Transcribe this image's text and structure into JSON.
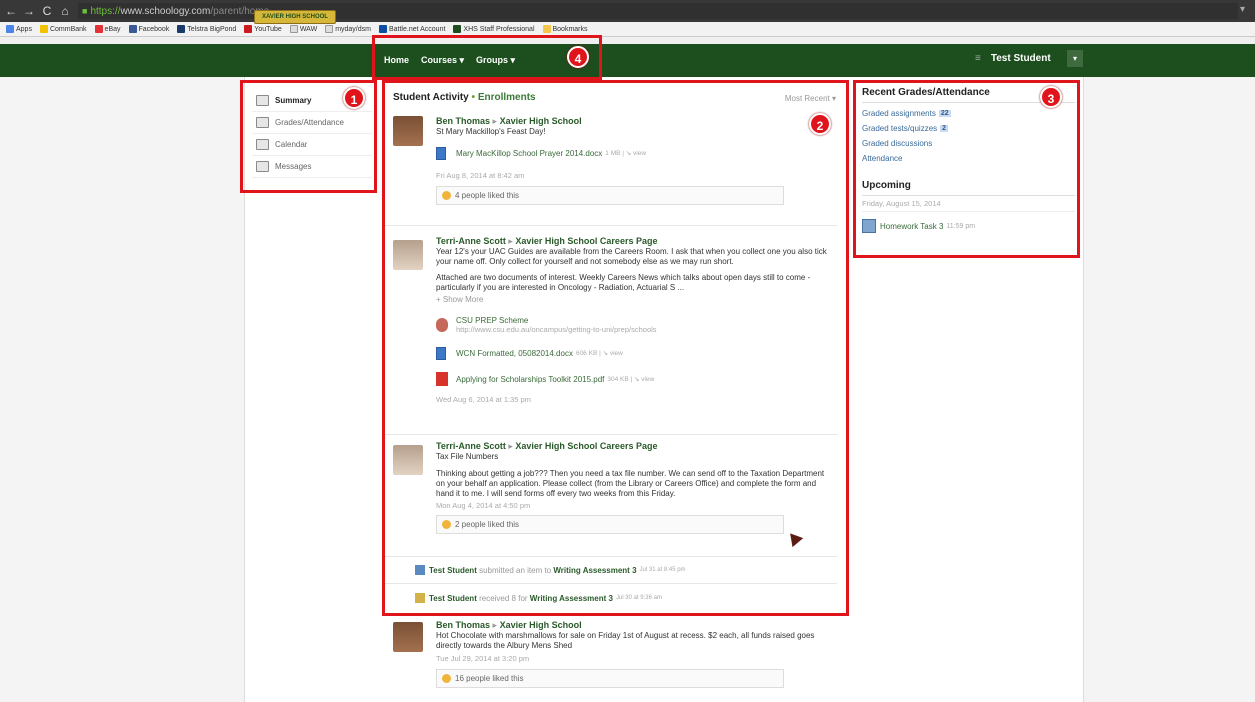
{
  "browser": {
    "url_secure": "https://",
    "url_host": "www.schoology.com",
    "url_path": "/parent/home",
    "bookmarks": [
      "Apps",
      "CommBank",
      "eBay",
      "Facebook",
      "Telstra BigPond",
      "YouTube",
      "WAW",
      "myday/dsm",
      "Battle.net Account",
      "XHS Staff Professional",
      "Bookmarks"
    ]
  },
  "header": {
    "logo_text": "XAVIER HIGH SCHOOL ALBURY",
    "nav": [
      "Home",
      "Courses ▾",
      "Groups ▾"
    ],
    "user_name": "Test Student",
    "menu_icon": "≡",
    "caret": "▾"
  },
  "sidebar": {
    "items": [
      {
        "label": "Summary",
        "icon": "summary-icon"
      },
      {
        "label": "Grades/Attendance",
        "icon": "grades-icon"
      },
      {
        "label": "Calendar",
        "icon": "calendar-icon"
      },
      {
        "label": "Messages",
        "icon": "messages-icon"
      }
    ]
  },
  "feed": {
    "title": "Student Activity",
    "sep": " • ",
    "enrollments": "Enrollments",
    "sort": "Most Recent ▾",
    "posts": [
      {
        "author": "Ben Thomas",
        "target": "Xavier High School",
        "text": "St Mary Mackillop's Feast Day!",
        "attachments": [
          {
            "name": "Mary MacKillop School Prayer 2014.docx",
            "meta": "1 MB | ↘ view",
            "type": "doc"
          }
        ],
        "time": "Fri Aug 8, 2014 at 8:42 am",
        "likes": "4 people liked this"
      },
      {
        "author": "Terri-Anne Scott",
        "target": "Xavier High School Careers Page",
        "text1": "Year 12's your UAC Guides are available from the Careers Room.  I ask that when you collect one you also tick your name off.  Only collect for yourself and not somebody else as we may run short.",
        "text2": "Attached are two documents of interest. Weekly Careers News which talks about open days still to come - particularly if you are interested in Oncology - Radiation, Actuarial S ...",
        "show_more": "+ Show More",
        "link_name": "CSU PREP Scheme",
        "link_url": "http://www.csu.edu.au/oncampus/getting-to-uni/prep/schools",
        "attachments": [
          {
            "name": "WCN Formatted, 05082014.docx",
            "meta": "606 KB | ↘ view",
            "type": "doc"
          },
          {
            "name": "Applying for Scholarships Toolkit 2015.pdf",
            "meta": "304 KB | ↘ view",
            "type": "pdf"
          }
        ],
        "time": "Wed Aug 6, 2014 at 1:35 pm"
      },
      {
        "author": "Terri-Anne Scott",
        "target": "Xavier High School Careers Page",
        "text1": "Tax File Numbers",
        "text2": "Thinking about getting a job??? Then you need a tax file number.  We can send off to the Taxation Department on your behalf an application.  Please collect (from the Library or Careers Office) and complete the form and hand it to me.  I will send forms off every two weeks from this Friday.",
        "time": "Mon Aug 4, 2014 at 4:50 pm",
        "likes": "2 people liked this"
      },
      {
        "author": "Ben Thomas",
        "target": "Xavier High School",
        "text": "Hot Chocolate with marshmallows for sale on Friday 1st of August at recess. $2 each, all funds raised goes directly towards the Albury Mens Shed",
        "time": "Tue Jul 29, 2014 at 3:20 pm",
        "likes": "16 people liked this"
      }
    ],
    "activities": [
      {
        "who": "Test Student",
        "action": "submitted an item to",
        "what": "Writing Assessment 3",
        "when": "Jul 31 at 8:45 pm"
      },
      {
        "who": "Test Student",
        "action": "received 8 for",
        "what": "Writing Assessment 3",
        "when": "Jul 30 at 9:36 am"
      }
    ]
  },
  "right_panel": {
    "title": "Recent Grades/Attendance",
    "links": [
      {
        "label": "Graded assignments",
        "badge": "22"
      },
      {
        "label": "Graded tests/quizzes",
        "badge": "2"
      },
      {
        "label": "Graded discussions",
        "badge": ""
      },
      {
        "label": "Attendance",
        "badge": ""
      }
    ],
    "upcoming_title": "Upcoming",
    "upcoming_date": "Friday, August 15, 2014",
    "upcoming_item": "Homework Task 3",
    "upcoming_time": "11:59 pm"
  },
  "annotations": [
    "1",
    "2",
    "3",
    "4"
  ],
  "colors": {
    "header": "#1d4e1e",
    "annotation": "#e0141b",
    "link": "#2a5a2a"
  }
}
